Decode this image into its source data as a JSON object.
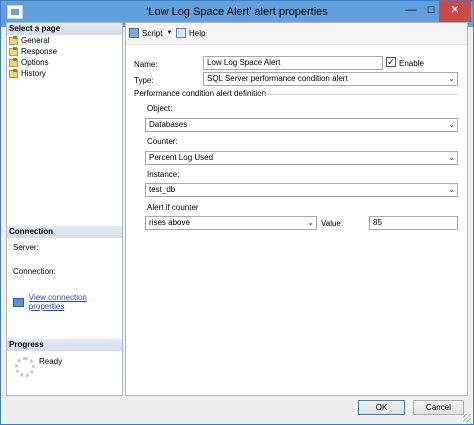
{
  "window": {
    "title": "'Low Log Space Alert' alert properties",
    "minimize": "—",
    "maximize": "☐",
    "close": "✕"
  },
  "left_pane": {
    "select_page_header": "Select a page",
    "pages": [
      {
        "label": "General",
        "icon": "page-icon"
      },
      {
        "label": "Response",
        "icon": "page-icon"
      },
      {
        "label": "Options",
        "icon": "page-icon"
      },
      {
        "label": "History",
        "icon": "page-icon"
      }
    ],
    "connection": {
      "header": "Connection",
      "server_label": "Server:",
      "connection_label": "Connection:",
      "view_properties_link": "View connection properties"
    },
    "progress": {
      "header": "Progress",
      "status": "Ready"
    }
  },
  "toolbar": {
    "script_label": "Script",
    "help_label": "Help"
  },
  "form": {
    "name_label": "Name:",
    "name_value": "Low Log Space Alert",
    "enable_label": "Enable",
    "enable_checked": true,
    "type_label": "Type:",
    "type_value": "SQL Server performance condition alert",
    "group_title": "Performance condition alert definition",
    "object_label": "Object:",
    "object_value": "Databases",
    "counter_label": "Counter:",
    "counter_value": "Percent Log Used",
    "instance_label": "Instance:",
    "instance_value": "test_db",
    "alert_if_label": "Alert if counter",
    "alert_if_value": "rises above",
    "value_label": "Value:",
    "value_value": "85"
  },
  "buttons": {
    "ok": "OK",
    "cancel": "Cancel"
  },
  "colors": {
    "titlebar": "#5fa0dd",
    "close_button": "#c74b4b",
    "link": "#2a4fb8"
  }
}
